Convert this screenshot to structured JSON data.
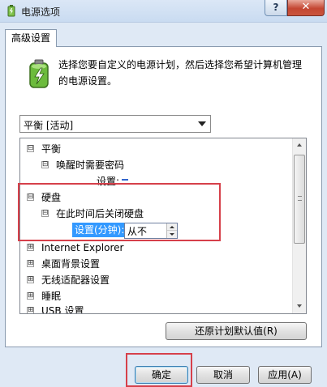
{
  "window": {
    "title": "电源选项",
    "help_label": "?",
    "close_label": "✕"
  },
  "tab": {
    "label": "高级设置"
  },
  "description": "选择您要自定义的电源计划，然后选择您希望计算机管理的电源设置。",
  "plan_select": {
    "selected": "平衡 [活动]"
  },
  "tree": {
    "plan_node": {
      "expander": "⊟",
      "label": "平衡"
    },
    "wake_password": {
      "expander": "⊟",
      "label": "唤醒时需要密码"
    },
    "wake_setting_label": "设置:",
    "hard_disk": {
      "expander": "⊟",
      "label": "硬盘"
    },
    "turn_off_disk": {
      "expander": "⊟",
      "label": "在此时间后关闭硬盘"
    },
    "disk_setting_label": "设置(分钟):",
    "disk_setting_value": "从不",
    "items": [
      {
        "expander": "⊞",
        "label": "Internet Explorer"
      },
      {
        "expander": "⊞",
        "label": "桌面背景设置"
      },
      {
        "expander": "⊞",
        "label": "无线适配器设置"
      },
      {
        "expander": "⊞",
        "label": "睡眠"
      },
      {
        "expander": "⊞",
        "label": "USB 设置"
      }
    ]
  },
  "buttons": {
    "restore": "还原计划默认值(R)",
    "ok": "确定",
    "cancel": "取消",
    "apply": "应用(A)"
  },
  "colors": {
    "highlight_box": "#d6404a",
    "selection": "#3399ff"
  }
}
